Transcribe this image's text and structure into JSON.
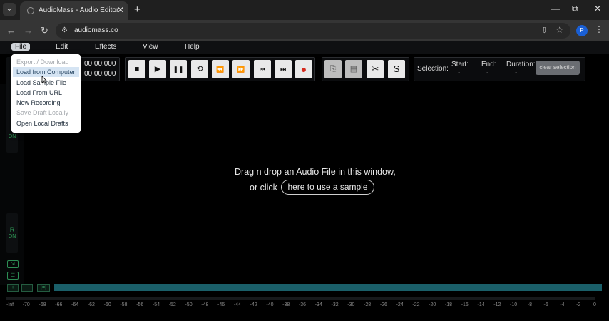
{
  "browser": {
    "tab_title": "AudioMass - Audio Editor",
    "tab_close": "✕",
    "new_tab": "+",
    "tab_list": "⌄",
    "window_controls": {
      "minimize": "—",
      "restore": "⧉",
      "close": "✕"
    },
    "nav": {
      "back": "←",
      "forward": "→",
      "reload": "↻"
    },
    "url": "audiomass.co",
    "profile_initial": "P",
    "menu_glyph": "⋮"
  },
  "menu": {
    "file": "File",
    "edit": "Edit",
    "effects": "Effects",
    "view": "View",
    "help": "Help"
  },
  "file_menu": {
    "items": [
      {
        "label": "Export / Download",
        "disabled": true
      },
      {
        "label": "Load from Computer",
        "disabled": false,
        "hover": true
      },
      {
        "label": "Load Sample File",
        "disabled": false
      },
      {
        "label": "Load From URL",
        "disabled": false
      },
      {
        "label": "New Recording",
        "disabled": false
      },
      {
        "label": "Save Draft Locally",
        "disabled": true
      },
      {
        "label": "Open Local Drafts",
        "disabled": false
      }
    ]
  },
  "transport": {
    "time_current": "00:00:000",
    "time_total": "00:00:000",
    "stop": "■",
    "play": "▶",
    "pause": "❚❚",
    "loop": "⟲",
    "rewind": "⏪",
    "fast_forward": "⏩",
    "skip_start": "⏮",
    "skip_end": "⏭",
    "record": "●"
  },
  "edit_tools": {
    "copy": "⎘",
    "paste": "▤",
    "cut": "✂",
    "silence": "S"
  },
  "selection": {
    "label": "Selection:",
    "start_label": "Start:",
    "start_value": "-",
    "end_label": "End:",
    "end_value": "-",
    "duration_label": "Duration:",
    "duration_value": "-",
    "clear_button": "clear selection"
  },
  "channels": {
    "left_on": "ON",
    "right_label": "R",
    "right_on": "ON"
  },
  "drop_zone": {
    "line1": "Drag n drop an Audio File in this window,",
    "line2_prefix": "or click",
    "sample_link": "here to use a sample"
  },
  "zoom": {
    "in": "+",
    "out": "−",
    "fit": "[=]"
  },
  "db_scale": [
    "-Inf",
    "-70",
    "-68",
    "-66",
    "-64",
    "-62",
    "-60",
    "-58",
    "-56",
    "-54",
    "-52",
    "-50",
    "-48",
    "-46",
    "-44",
    "-42",
    "-40",
    "-38",
    "-36",
    "-34",
    "-32",
    "-30",
    "-28",
    "-26",
    "-24",
    "-22",
    "-20",
    "-18",
    "-16",
    "-14",
    "-12",
    "-10",
    "-8",
    "-6",
    "-4",
    "-2",
    "0"
  ],
  "colors": {
    "accent_green": "#2e9a56",
    "overview_teal": "#1a5f69",
    "record_red": "#d52b1e",
    "menu_hover": "#d5e4f3"
  }
}
